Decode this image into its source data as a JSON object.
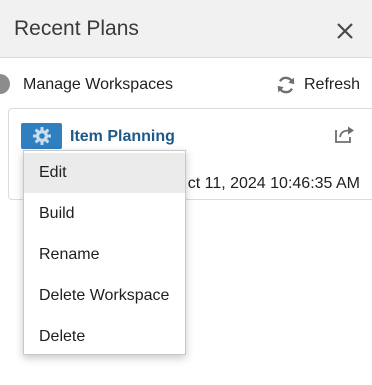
{
  "panel": {
    "title": "Recent Plans",
    "close_icon": "close-icon"
  },
  "toolbar": {
    "manage_label": "Manage Workspaces",
    "refresh_label": "Refresh",
    "refresh_icon": "refresh-icon"
  },
  "plan": {
    "name": "Item Planning",
    "date_visible": "ct 11, 2024 10:46:35 AM",
    "icon": "gear-icon",
    "icon_color": "#2f7fc1",
    "share_icon": "share-icon"
  },
  "context_menu": {
    "items": [
      {
        "label": "Edit",
        "highlighted": true
      },
      {
        "label": "Build"
      },
      {
        "label": "Rename"
      },
      {
        "label": "Delete Workspace"
      },
      {
        "label": "Delete"
      }
    ]
  }
}
